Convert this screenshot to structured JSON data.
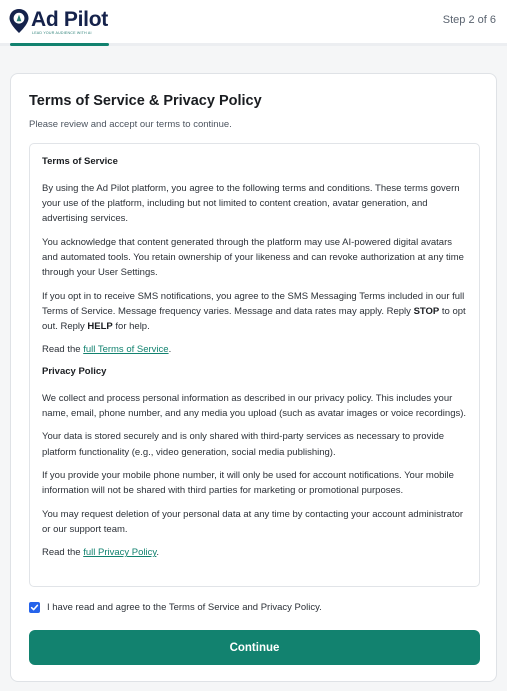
{
  "header": {
    "brand_name": "Ad Pilot",
    "brand_tagline": "LEAD YOUR AUDIENCE WITH AI",
    "step_label": "Step 2 of 6",
    "progress_fraction": 0.2,
    "accent_color": "#12826f"
  },
  "card": {
    "title": "Terms of Service & Privacy Policy",
    "subtitle": "Please review and accept our terms to continue."
  },
  "terms": {
    "tos_heading": "Terms of Service",
    "tos_p1": "By using the Ad Pilot platform, you agree to the following terms and conditions. These terms govern your use of the platform, including but not limited to content creation, avatar generation, and advertising services.",
    "tos_p2": "You acknowledge that content generated through the platform may use AI-powered digital avatars and automated tools. You retain ownership of your likeness and can revoke authorization at any time through your User Settings.",
    "sms_part1": "If you opt in to receive SMS notifications, you agree to the SMS Messaging Terms included in our full Terms of Service. Message frequency varies. Message and data rates may apply. Reply ",
    "sms_stop": "STOP",
    "sms_part2": " to opt out. Reply ",
    "sms_help": "HELP",
    "sms_part3": " for help.",
    "read_prefix_1": "Read the ",
    "tos_link": "full Terms of Service",
    "read_suffix_1": ".",
    "pp_heading": "Privacy Policy",
    "pp_p1": "We collect and process personal information as described in our privacy policy. This includes your name, email, phone number, and any media you upload (such as avatar images or voice recordings).",
    "pp_p2": "Your data is stored securely and is only shared with third-party services as necessary to provide platform functionality (e.g., video generation, social media publishing).",
    "pp_p3": "If you provide your mobile phone number, it will only be used for account notifications. Your mobile information will not be shared with third parties for marketing or promotional purposes.",
    "pp_p4": "You may request deletion of your personal data at any time by contacting your account administrator or our support team.",
    "read_prefix_2": "Read the ",
    "pp_link": "full Privacy Policy",
    "read_suffix_2": "."
  },
  "agreement": {
    "checked": true,
    "label": "I have read and agree to the Terms of Service and Privacy Policy."
  },
  "actions": {
    "continue_label": "Continue"
  },
  "icons": {
    "logo": "map-pin-logo-icon",
    "checkbox": "checkmark-icon"
  }
}
